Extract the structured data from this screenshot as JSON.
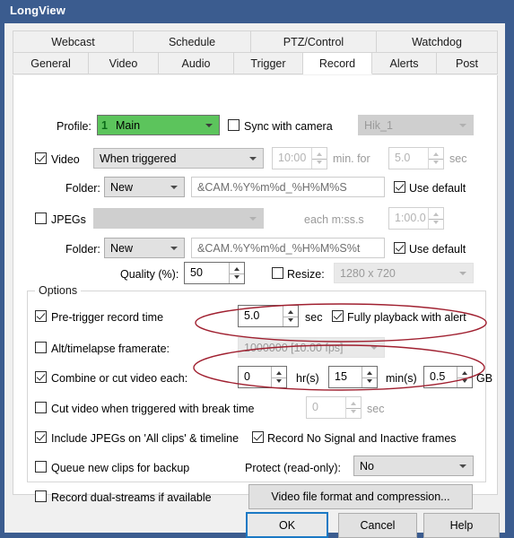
{
  "window": {
    "title": "LongView",
    "frame_color": "#3b5c8f",
    "client_bg": "#f0f0f0"
  },
  "tabs": {
    "row1": [
      {
        "label": "Webcast",
        "selected": false
      },
      {
        "label": "Schedule",
        "selected": false
      },
      {
        "label": "PTZ/Control",
        "selected": false
      },
      {
        "label": "Watchdog",
        "selected": false
      }
    ],
    "row2": [
      {
        "label": "General",
        "selected": false
      },
      {
        "label": "Video",
        "selected": false
      },
      {
        "label": "Audio",
        "selected": false
      },
      {
        "label": "Trigger",
        "selected": false
      },
      {
        "label": "Record",
        "selected": true
      },
      {
        "label": "Alerts",
        "selected": false
      },
      {
        "label": "Post",
        "selected": false
      }
    ]
  },
  "record": {
    "profile": {
      "label": "Profile:",
      "index": "1",
      "value": "Main",
      "accent": "#5cc45c"
    },
    "sync": {
      "label": "Sync with camera",
      "checked": false,
      "camera": "Hik_1",
      "camera_enabled": false
    },
    "video": {
      "label": "Video",
      "checked": true,
      "mode": "When triggered",
      "interval": "10:00",
      "interval_unit": "min. for",
      "duration": "5.0",
      "duration_unit": "sec",
      "interval_enabled": false,
      "duration_enabled": false
    },
    "video_folder": {
      "label": "Folder:",
      "mode": "New",
      "pattern": "&CAM.%Y%m%d_%H%M%S",
      "use_default_label": "Use default",
      "use_default": true
    },
    "jpegs": {
      "label": "JPEGs",
      "checked": false,
      "mode": "",
      "each_label": "each m:ss.s",
      "each_value": "1:00.0",
      "enabled": false
    },
    "jpeg_folder": {
      "label": "Folder:",
      "mode": "New",
      "pattern": "&CAM.%Y%m%d_%H%M%S%t",
      "use_default_label": "Use default",
      "use_default": true
    },
    "quality": {
      "label": "Quality (%):",
      "value": "50"
    },
    "resize": {
      "label": "Resize:",
      "checked": false,
      "value": "1280 x 720",
      "enabled": false
    },
    "options": {
      "title": "Options",
      "pretrigger": {
        "label": "Pre-trigger record time",
        "checked": true,
        "value": "5.0",
        "unit": "sec"
      },
      "fully_playback": {
        "label": "Fully playback with alert",
        "checked": true
      },
      "alt_framerate": {
        "label": "Alt/timelapse framerate:",
        "checked": false,
        "value": "1000000 [10.00 fps]",
        "enabled": false
      },
      "combine": {
        "label": "Combine or cut video each:",
        "checked": true,
        "hours": "0",
        "hours_unit": "hr(s)",
        "minutes": "15",
        "minutes_unit": "min(s)",
        "size": "0.5",
        "size_unit": "GB"
      },
      "cut_on_trigger": {
        "label": "Cut video when triggered with break time",
        "checked": false,
        "value": "0",
        "unit": "sec",
        "enabled": false
      },
      "include_jpegs": {
        "label": "Include JPEGs on 'All clips' & timeline",
        "checked": true
      },
      "record_nosignal": {
        "label": "Record No Signal and Inactive frames",
        "checked": true
      },
      "queue_backup": {
        "label": "Queue new clips for backup",
        "checked": false
      },
      "protect": {
        "label": "Protect (read-only):",
        "value": "No"
      },
      "dual_streams": {
        "label": "Record dual-streams if available",
        "checked": false
      },
      "video_format_button": "Video file format and compression..."
    }
  },
  "footer": {
    "ok": "OK",
    "cancel": "Cancel",
    "help": "Help"
  },
  "annotations": {
    "color": "#a02030",
    "ellipse_count": 2
  }
}
